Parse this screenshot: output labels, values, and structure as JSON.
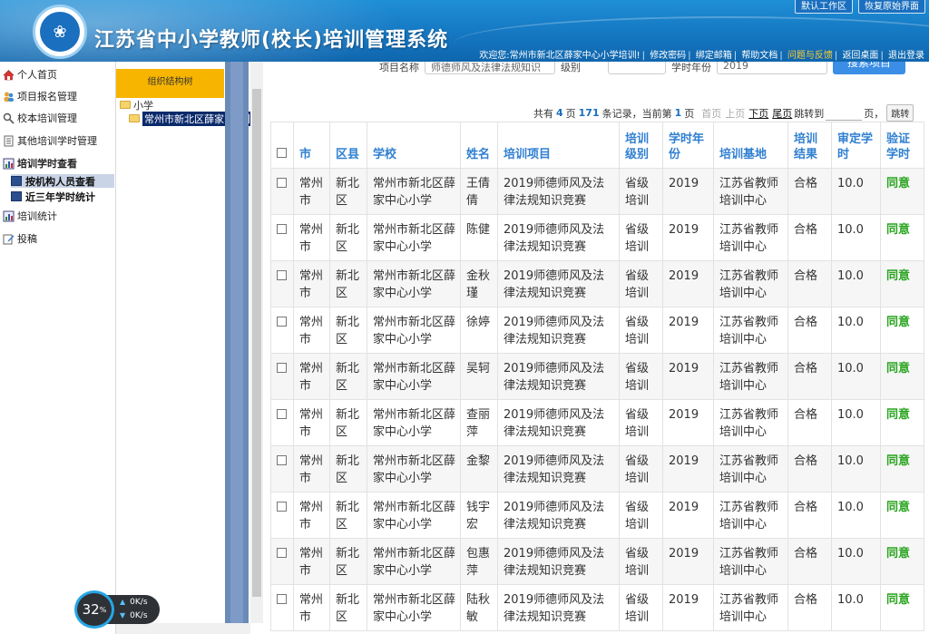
{
  "header": {
    "title": "江苏省中小学教师(校长)培训管理系统",
    "top_buttons": [
      "默认工作区",
      "恢复原始界面"
    ],
    "welcome": "欢迎您:常州市新北区薛家中心小学培训!",
    "links": [
      "修改密码",
      "绑定邮箱",
      "帮助文档",
      "问题与反馈",
      "返回桌面",
      "退出登录"
    ]
  },
  "nav": {
    "items": [
      {
        "label": "个人首页",
        "icon": "home-icon"
      },
      {
        "label": "项目报名管理",
        "icon": "users-icon"
      },
      {
        "label": "校本培训管理",
        "icon": "search-icon"
      },
      {
        "label": "其他培训学时管理",
        "icon": "document-icon"
      },
      {
        "label": "培训学时查看",
        "icon": "chart-icon"
      },
      {
        "label": "培训统计",
        "icon": "chart-icon"
      },
      {
        "label": "投稿",
        "icon": "edit-icon"
      }
    ],
    "sub_items": [
      "按机构人员查看",
      "近三年学时统计"
    ]
  },
  "tree": {
    "header": "组织结构树",
    "root": "小学",
    "selected": "常州市新北区薛家中心小学"
  },
  "search": {
    "field1_label": "项目名称",
    "field1_value": "师德师风及法律法规知识",
    "field2_label": "级别",
    "field3_label": "学时年份",
    "field3_value": "2019",
    "button": "搜索项目"
  },
  "pager": {
    "prefix": "共有",
    "pages": "4",
    "pages_unit": "页",
    "records": "171",
    "records_unit": "条记录，当前第",
    "current": "1",
    "current_unit": "页",
    "first": "首页",
    "prev": "上页",
    "next": "下页",
    "last": "尾页",
    "jump_label": "跳转到",
    "jump_unit": "页，",
    "go": "跳转"
  },
  "table": {
    "headers": [
      "市",
      "区县",
      "学校",
      "姓名",
      "培训项目",
      "培训级别",
      "学时年份",
      "培训基地",
      "培训结果",
      "审定学时",
      "验证学时"
    ],
    "rows": [
      {
        "city": "常州市",
        "district": "新北区",
        "school": "常州市新北区薛家中心小学",
        "name": "王倩倩",
        "project": "2019师德师风及法律法规知识竞赛",
        "level": "省级培训",
        "year": "2019",
        "base": "江苏省教师培训中心",
        "result": "合格",
        "hours": "10.0",
        "verify": "同意"
      },
      {
        "city": "常州市",
        "district": "新北区",
        "school": "常州市新北区薛家中心小学",
        "name": "陈健",
        "project": "2019师德师风及法律法规知识竞赛",
        "level": "省级培训",
        "year": "2019",
        "base": "江苏省教师培训中心",
        "result": "合格",
        "hours": "10.0",
        "verify": "同意"
      },
      {
        "city": "常州市",
        "district": "新北区",
        "school": "常州市新北区薛家中心小学",
        "name": "金秋瑾",
        "project": "2019师德师风及法律法规知识竞赛",
        "level": "省级培训",
        "year": "2019",
        "base": "江苏省教师培训中心",
        "result": "合格",
        "hours": "10.0",
        "verify": "同意"
      },
      {
        "city": "常州市",
        "district": "新北区",
        "school": "常州市新北区薛家中心小学",
        "name": "徐婷",
        "project": "2019师德师风及法律法规知识竞赛",
        "level": "省级培训",
        "year": "2019",
        "base": "江苏省教师培训中心",
        "result": "合格",
        "hours": "10.0",
        "verify": "同意"
      },
      {
        "city": "常州市",
        "district": "新北区",
        "school": "常州市新北区薛家中心小学",
        "name": "吴轲",
        "project": "2019师德师风及法律法规知识竞赛",
        "level": "省级培训",
        "year": "2019",
        "base": "江苏省教师培训中心",
        "result": "合格",
        "hours": "10.0",
        "verify": "同意"
      },
      {
        "city": "常州市",
        "district": "新北区",
        "school": "常州市新北区薛家中心小学",
        "name": "查丽萍",
        "project": "2019师德师风及法律法规知识竞赛",
        "level": "省级培训",
        "year": "2019",
        "base": "江苏省教师培训中心",
        "result": "合格",
        "hours": "10.0",
        "verify": "同意"
      },
      {
        "city": "常州市",
        "district": "新北区",
        "school": "常州市新北区薛家中心小学",
        "name": "金黎",
        "project": "2019师德师风及法律法规知识竞赛",
        "level": "省级培训",
        "year": "2019",
        "base": "江苏省教师培训中心",
        "result": "合格",
        "hours": "10.0",
        "verify": "同意"
      },
      {
        "city": "常州市",
        "district": "新北区",
        "school": "常州市新北区薛家中心小学",
        "name": "钱宇宏",
        "project": "2019师德师风及法律法规知识竞赛",
        "level": "省级培训",
        "year": "2019",
        "base": "江苏省教师培训中心",
        "result": "合格",
        "hours": "10.0",
        "verify": "同意"
      },
      {
        "city": "常州市",
        "district": "新北区",
        "school": "常州市新北区薛家中心小学",
        "name": "包惠萍",
        "project": "2019师德师风及法律法规知识竞赛",
        "level": "省级培训",
        "year": "2019",
        "base": "江苏省教师培训中心",
        "result": "合格",
        "hours": "10.0",
        "verify": "同意"
      },
      {
        "city": "常州市",
        "district": "新北区",
        "school": "常州市新北区薛家中心小学",
        "name": "陆秋敏",
        "project": "2019师德师风及法律法规知识竞赛",
        "level": "省级培训",
        "year": "2019",
        "base": "江苏省教师培训中心",
        "result": "合格",
        "hours": "10.0",
        "verify": "同意"
      }
    ]
  },
  "speed_widget": {
    "percent": "32",
    "percent_unit": "%",
    "up": "0K/s",
    "down": "0K/s"
  }
}
